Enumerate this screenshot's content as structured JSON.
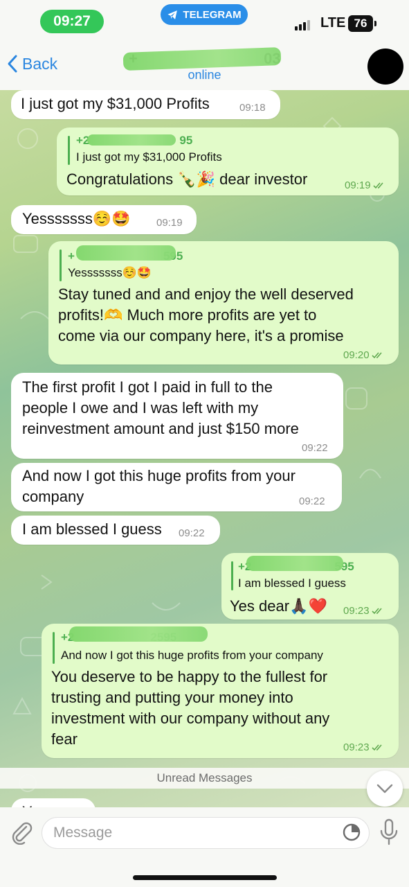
{
  "status_bar": {
    "time": "09:27",
    "app_pill": "TELEGRAM",
    "network": "LTE",
    "battery": "76"
  },
  "header": {
    "back_label": "Back",
    "contact_name_prefix": "+",
    "contact_name_suffix": "03",
    "status": "online"
  },
  "messages": [
    {
      "id": "m1",
      "dir": "in",
      "text": "I just got my $31,000 Profits",
      "time": "09:18"
    },
    {
      "id": "m2",
      "dir": "out",
      "reply_name": "+2",
      "reply_name_suffix": "95",
      "reply_text": "I just got my $31,000 Profits",
      "text": "Congratulations",
      "emoji": "🍾🎉",
      "text_after": " dear investor",
      "time": "09:19",
      "read": true
    },
    {
      "id": "m3",
      "dir": "in",
      "text": "Yesssssss",
      "emoji": "☺️🤩",
      "time": "09:19"
    },
    {
      "id": "m4",
      "dir": "out",
      "reply_name": "+",
      "reply_name_suffix": "595",
      "reply_text": "Yesssssss",
      "reply_emoji": "☺️🤩",
      "lines": [
        "Stay tuned and and enjoy the well deserved",
        "profits!🫶 Much more profits are yet to",
        "come via our company here, it's a promise"
      ],
      "time": "09:20",
      "read": true
    },
    {
      "id": "m5",
      "dir": "in",
      "lines": [
        "The first profit I got I paid in full to the",
        "people I owe and I was left with my",
        "reinvestment amount and just $150 more"
      ],
      "time": "09:22"
    },
    {
      "id": "m6",
      "dir": "in",
      "lines": [
        "And now I got this huge profits from your",
        "company"
      ],
      "time": "09:22"
    },
    {
      "id": "m7",
      "dir": "in",
      "text": "I am blessed I guess",
      "time": "09:22"
    },
    {
      "id": "m8",
      "dir": "out",
      "reply_name": "+2",
      "reply_name_suffix": "595",
      "reply_text": "I am blessed I guess",
      "text": "Yes dear",
      "emoji": "🙏🏿❤️",
      "time": "09:23",
      "read": true
    },
    {
      "id": "m9",
      "dir": "out",
      "reply_name": "+2",
      "reply_name_suffix": "2595",
      "reply_text": "And now I got this huge profits from your company",
      "lines": [
        "You deserve to be happy to the fullest for",
        "trusting and putting your money into",
        "investment with our company without any",
        "fear"
      ],
      "time": "09:23",
      "read": true
    },
    {
      "id": "m10",
      "dir": "in",
      "text": "Yes",
      "time": ""
    }
  ],
  "unread_label": "Unread Messages",
  "input": {
    "placeholder": "Message"
  },
  "colors": {
    "accent_blue": "#2a86e0",
    "time_pill_green": "#34c759",
    "outgoing_bubble": "#e2fbc9",
    "incoming_bubble": "#ffffff",
    "reply_green": "#4caf50"
  }
}
